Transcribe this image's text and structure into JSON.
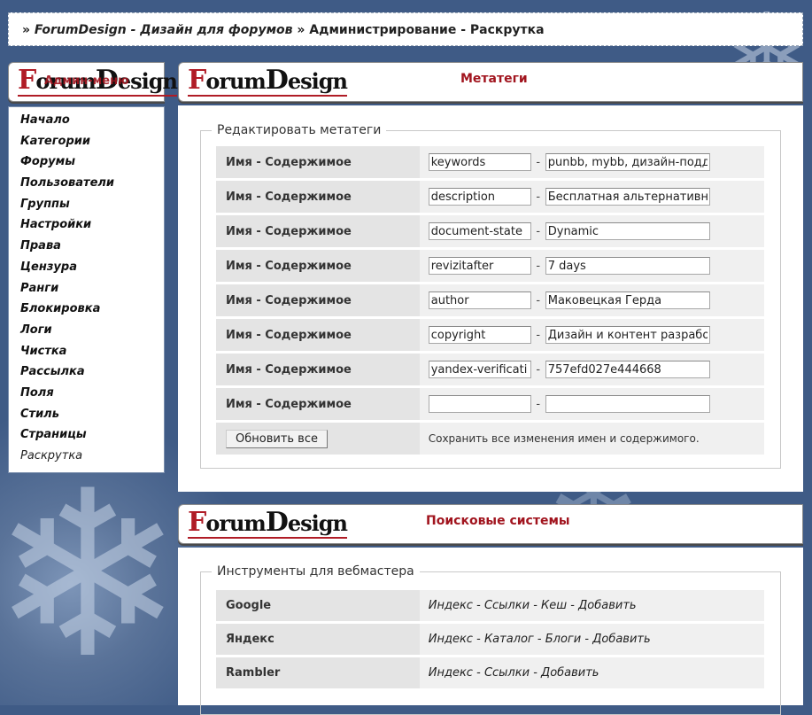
{
  "breadcrumb": {
    "prefix": "»",
    "site": "ForumDesign - Дизайн для форумов",
    "sep": "»",
    "page": "Администрирование - Раскрутка"
  },
  "logo": {
    "first_letter": "F",
    "rest1": "orum",
    "second_letter": "D",
    "rest2": "esign"
  },
  "sidebar": {
    "title": "Админ-меню",
    "items": [
      "Начало",
      "Категории",
      "Форумы",
      "Пользователи",
      "Группы",
      "Настройки",
      "Права",
      "Цензура",
      "Ранги",
      "Блокировка",
      "Логи",
      "Чистка",
      "Рассылка",
      "Поля",
      "Стиль",
      "Страницы",
      "Раскрутка"
    ],
    "active": "Раскрутка"
  },
  "metatags": {
    "header": "Метатеги",
    "legend": "Редактировать метатеги",
    "row_label": "Имя - Содержимое",
    "rows": [
      {
        "name": "keywords",
        "content": "punbb, mybb, дизайн-подд"
      },
      {
        "name": "description",
        "content": "Бесплатная альтернативна"
      },
      {
        "name": "document-state",
        "content": "Dynamic"
      },
      {
        "name": "revizitafter",
        "content": "7 days"
      },
      {
        "name": "author",
        "content": "Маковецкая Герда"
      },
      {
        "name": "copyright",
        "content": "Дизайн и контент разрабо"
      },
      {
        "name": "yandex-verificati",
        "content": "757efd027e444668"
      },
      {
        "name": "",
        "content": ""
      }
    ],
    "separator": "-",
    "update_button": "Обновить все",
    "update_note": "Сохранить все изменения имен и содержимого."
  },
  "search": {
    "header": "Поисковые системы",
    "legend": "Инструменты для вебмастера",
    "engines": [
      {
        "name": "Google",
        "links": [
          "Индекс",
          "Ссылки",
          "Кеш",
          "Добавить"
        ]
      },
      {
        "name": "Яндекс",
        "links": [
          "Индекс",
          "Каталог",
          "Блоги",
          "Добавить"
        ]
      },
      {
        "name": "Rambler",
        "links": [
          "Индекс",
          "Ссылки",
          "Добавить"
        ]
      }
    ],
    "link_sep": "-"
  }
}
